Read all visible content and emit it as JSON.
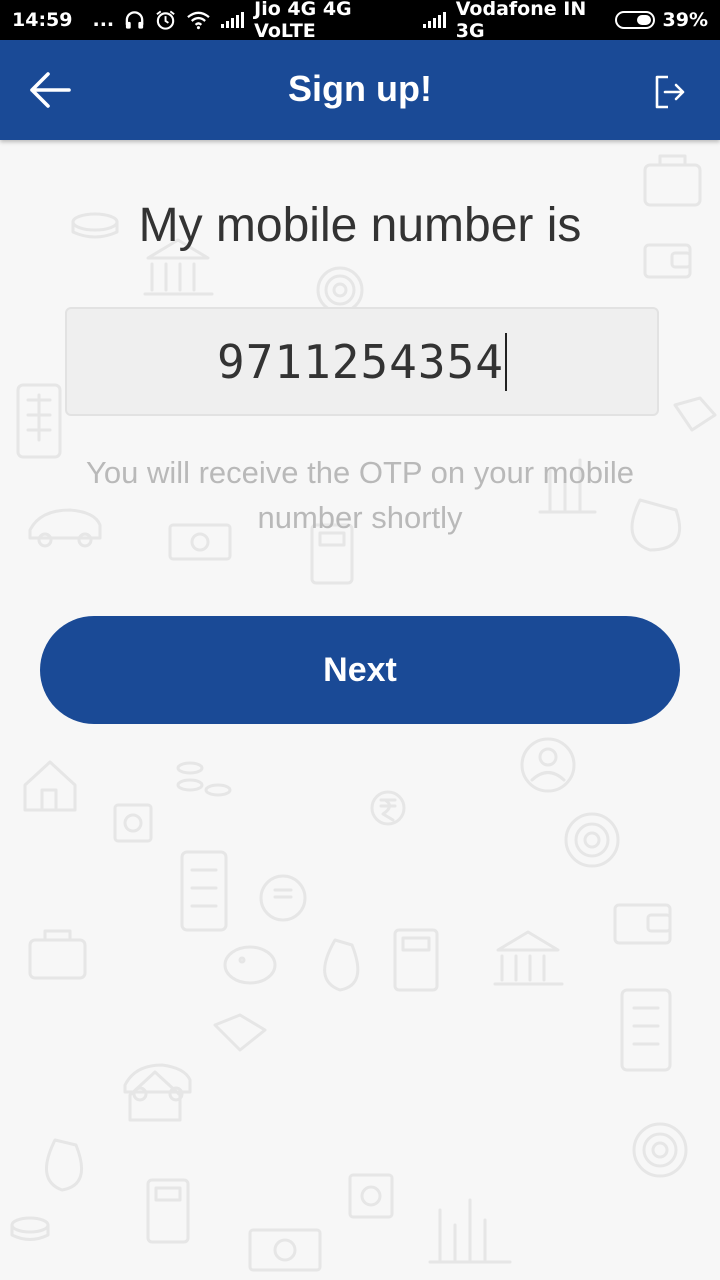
{
  "status_bar": {
    "time": "14:59",
    "overflow": "...",
    "carrier1": "Jio 4G 4G VoLTE",
    "carrier2": "Vodafone IN 3G",
    "battery": "39%",
    "icons": [
      "headphones-icon",
      "alarm-icon",
      "wifi-icon",
      "signal-icon",
      "battery-icon"
    ]
  },
  "header": {
    "title": "Sign up!",
    "back_icon": "arrow-left-icon",
    "exit_icon": "logout-icon",
    "color": "#1a4a96"
  },
  "form": {
    "heading": "My mobile number is",
    "phone_value": "9711254354",
    "hint": "You will receive the OTP on your mobile number shortly",
    "next_label": "Next"
  },
  "colors": {
    "primary": "#1a4a96",
    "heading_text": "#333333",
    "hint_text": "#b9b9b9",
    "input_bg": "#efefef"
  }
}
